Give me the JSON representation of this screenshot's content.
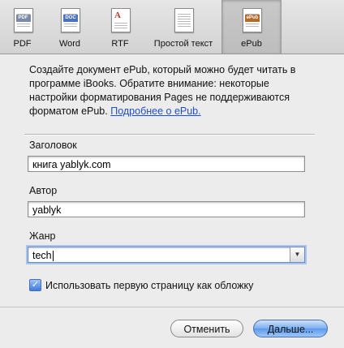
{
  "toolbar": {
    "items": [
      {
        "label": "PDF",
        "icon": "pdf-doc-icon",
        "tag": "PDF"
      },
      {
        "label": "Word",
        "icon": "word-doc-icon",
        "tag": "DOC"
      },
      {
        "label": "RTF",
        "icon": "rtf-doc-icon",
        "tag": "A"
      },
      {
        "label": "Простой текст",
        "icon": "text-doc-icon",
        "tag": ""
      },
      {
        "label": "ePub",
        "icon": "epub-doc-icon",
        "tag": "ePub"
      }
    ],
    "active": "ePub"
  },
  "description": {
    "text": "Создайте документ ePub, который можно будет читать в программе iBooks. Обратите внимание: некоторые настройки форматирования Pages не поддерживаются форматом ePub.",
    "link": "Подробнее о ePub."
  },
  "fields": {
    "title_label": "Заголовок",
    "title_value": "книга yablyk.com",
    "author_label": "Автор",
    "author_value": "yablyk",
    "genre_label": "Жанр",
    "genre_value": "tech"
  },
  "cover_checkbox": {
    "label": "Использовать первую страницу как обложку",
    "checked": true
  },
  "buttons": {
    "cancel": "Отменить",
    "next": "Дальше..."
  },
  "colors": {
    "link": "#1f4fc8",
    "default_button": "#5d9aeb",
    "focus_ring": "#a9c4ee"
  }
}
